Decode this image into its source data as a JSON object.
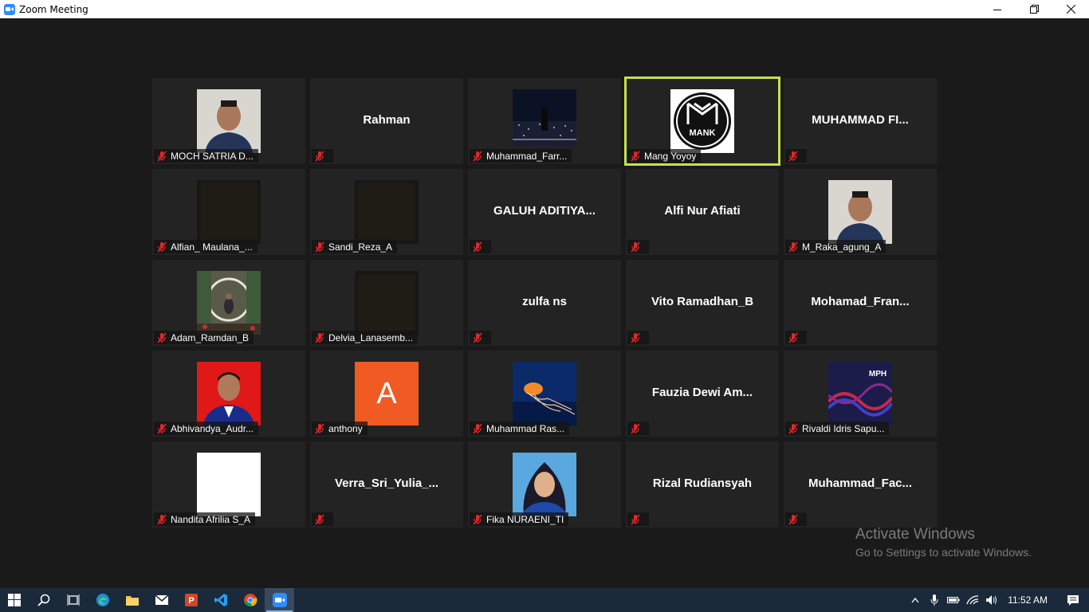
{
  "window": {
    "title": "Zoom Meeting"
  },
  "participants": [
    {
      "big_name": "",
      "name": "MOCH SATRIA D...",
      "photo": "person-portrait"
    },
    {
      "big_name": "Rahman",
      "name": "",
      "photo": ""
    },
    {
      "big_name": "",
      "name": "Muhammad_Farr...",
      "photo": "night-city"
    },
    {
      "big_name": "",
      "name": "Mang Yoyoy",
      "photo": "mank-logo",
      "active_speaker": true
    },
    {
      "big_name": "MUHAMMAD FI...",
      "name": "",
      "photo": ""
    },
    {
      "big_name": "",
      "name": "Alfian_ Maulana_...",
      "photo": "dark-video"
    },
    {
      "big_name": "",
      "name": "Sandi_Reza_A",
      "photo": "dark-video"
    },
    {
      "big_name": "GALUH ADITIYA...",
      "name": "",
      "photo": ""
    },
    {
      "big_name": "Alfi Nur Afiati",
      "name": "",
      "photo": ""
    },
    {
      "big_name": "",
      "name": "M_Raka_agung_A",
      "photo": "person-portrait"
    },
    {
      "big_name": "",
      "name": "Adam_Ramdan_B",
      "photo": "wedding-photo"
    },
    {
      "big_name": "",
      "name": "Delvia_Lanasemb...",
      "photo": "dark-video"
    },
    {
      "big_name": "zulfa ns",
      "name": "",
      "photo": ""
    },
    {
      "big_name": "Vito Ramadhan_B",
      "name": "",
      "photo": ""
    },
    {
      "big_name": "Mohamad_Fran...",
      "name": "",
      "photo": ""
    },
    {
      "big_name": "",
      "name": "Abhivandya_Audr...",
      "photo": "red-portrait"
    },
    {
      "big_name": "",
      "name": "anthony",
      "photo": "initial-avatar",
      "initial": "A"
    },
    {
      "big_name": "",
      "name": "Muhammad Ras...",
      "photo": "jellyfish"
    },
    {
      "big_name": "Fauzia Dewi Am...",
      "name": "",
      "photo": ""
    },
    {
      "big_name": "",
      "name": "Rivaldi Idris Sapu...",
      "photo": "mph-logo",
      "logo_text": "MPH"
    },
    {
      "big_name": "",
      "name": "Nandita Afrilia S_A",
      "photo": "white-blank"
    },
    {
      "big_name": "Verra_Sri_Yulia_...",
      "name": "",
      "photo": ""
    },
    {
      "big_name": "",
      "name": "Fika NURAENI_TI",
      "photo": "hijab-portrait"
    },
    {
      "big_name": "Rizal Rudiansyah",
      "name": "",
      "photo": ""
    },
    {
      "big_name": "Muhammad_Fac...",
      "name": "",
      "photo": ""
    }
  ],
  "logo": {
    "mank_text": "MANK"
  },
  "watermark": {
    "line1": "Activate Windows",
    "line2": "Go to Settings to activate Windows."
  },
  "taskbar": {
    "apps": [
      "start-icon",
      "search-icon",
      "task-view-icon",
      "edge-icon",
      "file-explorer-icon",
      "mail-icon",
      "powerpoint-icon",
      "vscode-icon",
      "chrome-icon",
      "zoom-icon"
    ],
    "clock": "11:52 AM"
  },
  "colors": {
    "active_speaker": "#c4e24a",
    "mute_red": "#e02828",
    "tile_bg": "#232323",
    "avatar_orange": "#f05a23"
  }
}
